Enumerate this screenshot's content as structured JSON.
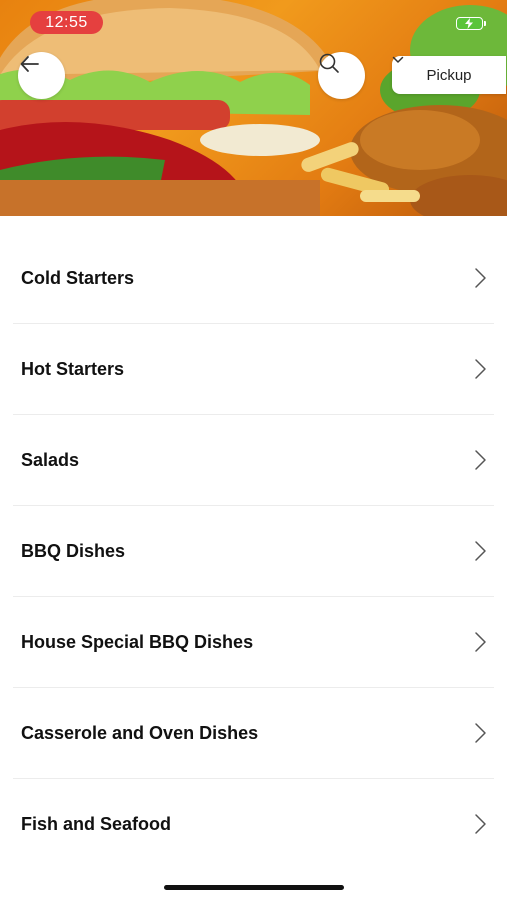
{
  "status_bar": {
    "time": "12:55",
    "battery_color": "#5ac43b"
  },
  "header": {
    "back_icon": "arrow-left-icon",
    "search_icon": "search-icon",
    "order_mode_label": "Pickup",
    "order_mode_icon": "chevron-down-icon"
  },
  "categories": [
    {
      "label": "Cold Starters"
    },
    {
      "label": "Hot Starters"
    },
    {
      "label": "Salads"
    },
    {
      "label": "BBQ Dishes"
    },
    {
      "label": "House Special BBQ Dishes"
    },
    {
      "label": "Casserole and Oven Dishes"
    },
    {
      "label": "Fish and Seafood"
    }
  ]
}
